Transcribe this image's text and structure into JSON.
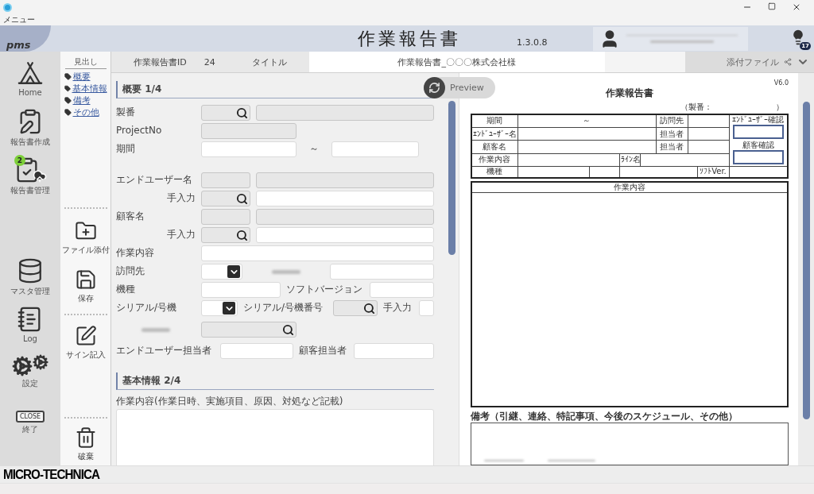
{
  "window": {
    "menu": "メニュー"
  },
  "header": {
    "logo": "pms",
    "title": "作業報告書",
    "version": "1.3.0.8",
    "notifications": "17"
  },
  "nav": {
    "top": [
      {
        "kind": "home",
        "label": "Home"
      },
      {
        "kind": "create",
        "label": "報告書作成"
      },
      {
        "kind": "manage",
        "label": "報告書管理",
        "badge": "2"
      }
    ],
    "bottom": [
      {
        "kind": "master",
        "label": "マスタ管理"
      },
      {
        "kind": "log",
        "label": "Log"
      },
      {
        "kind": "settings",
        "label": "設定"
      },
      {
        "kind": "close",
        "label": "終了",
        "sign": "CLOSE"
      }
    ]
  },
  "outline": {
    "heading": "見出し",
    "links": [
      "概要",
      "基本情報",
      "備考",
      "その他"
    ]
  },
  "actions": [
    {
      "kind": "attach",
      "label": "ファイル添付"
    },
    {
      "kind": "save",
      "label": "保存"
    },
    {
      "kind": "sign",
      "label": "サイン記入"
    },
    {
      "kind": "discard",
      "label": "破棄"
    }
  ],
  "topbar": {
    "id_label": "作業報告書ID",
    "id": "24",
    "title_label": "タイトル",
    "title_value": "作業報告書_〇〇〇株式会社様",
    "attachments": "添付ファイル"
  },
  "preview_button": "Preview",
  "form": {
    "sections": [
      {
        "title": "概要 1/4",
        "rows": [
          {
            "items": [
              {
                "kind": "label",
                "text": "製番"
              },
              {
                "kind": "search",
                "disabled": true
              },
              {
                "kind": "text",
                "disabled": true
              }
            ]
          },
          {
            "items": [
              {
                "kind": "label",
                "text": "ProjectNo"
              },
              {
                "kind": "text",
                "disabled": true
              }
            ]
          },
          {
            "items": [
              {
                "kind": "label",
                "text": "期間"
              },
              {
                "kind": "text",
                "disabled": false
              },
              {
                "kind": "tilde",
                "text": "～"
              },
              {
                "kind": "text",
                "disabled": false
              }
            ]
          },
          {
            "items": [
              {
                "kind": "label",
                "text": "エンドユーザー名"
              },
              {
                "kind": "text",
                "disabled": true
              },
              {
                "kind": "text",
                "disabled": true
              }
            ]
          },
          {
            "items": [
              {
                "kind": "sublabel",
                "text": "手入力"
              },
              {
                "kind": "search",
                "disabled": true
              },
              {
                "kind": "text",
                "disabled": false
              }
            ]
          },
          {
            "items": [
              {
                "kind": "label",
                "text": "顧客名"
              },
              {
                "kind": "text",
                "disabled": true
              },
              {
                "kind": "text",
                "disabled": true
              }
            ]
          },
          {
            "items": [
              {
                "kind": "sublabel",
                "text": "手入力"
              },
              {
                "kind": "search",
                "disabled": true
              },
              {
                "kind": "text",
                "disabled": false
              }
            ]
          },
          {
            "items": [
              {
                "kind": "label",
                "text": "作業内容"
              },
              {
                "kind": "text",
                "disabled": false
              }
            ]
          },
          {
            "items": [
              {
                "kind": "label",
                "text": "訪問先"
              },
              {
                "kind": "select",
                "disabled": false
              },
              {
                "kind": "redacted"
              },
              {
                "kind": "text",
                "disabled": false
              }
            ]
          },
          {
            "items": [
              {
                "kind": "label",
                "text": "機種"
              },
              {
                "kind": "text",
                "disabled": false
              },
              {
                "kind": "label",
                "text": "ソフトバージョン"
              },
              {
                "kind": "text",
                "disabled": false
              }
            ]
          },
          {
            "items": [
              {
                "kind": "label",
                "text": "シリアル/号機"
              },
              {
                "kind": "select",
                "disabled": false
              },
              {
                "kind": "label",
                "text": "シリアル/号機番号"
              },
              {
                "kind": "search",
                "disabled": true
              },
              {
                "kind": "label",
                "text": "手入力"
              },
              {
                "kind": "text",
                "disabled": false
              }
            ]
          },
          {
            "items": [
              {
                "kind": "redacted"
              },
              {
                "kind": "search",
                "disabled": true
              }
            ]
          },
          {
            "items": [
              {
                "kind": "label",
                "text": "エンドユーザー担当者"
              },
              {
                "kind": "text",
                "disabled": false
              },
              {
                "kind": "label",
                "text": "顧客担当者"
              },
              {
                "kind": "text",
                "disabled": false
              }
            ]
          }
        ]
      },
      {
        "title": "基本情報 2/4",
        "rows": [
          {
            "items": [
              {
                "kind": "caption",
                "text": "作業内容(作業日時、実施項目、原因、対処など記載)"
              }
            ]
          },
          {
            "items": [
              {
                "kind": "textarea",
                "disabled": false
              }
            ]
          }
        ]
      }
    ]
  },
  "document": {
    "title": "作業報告書",
    "version": "V6.0",
    "serial_label": "（製番：",
    "serial_close": "）",
    "fields": {
      "period": "期間",
      "tilde": "～",
      "visit": "訪問先",
      "end_user": "ｴﾝﾄﾞﾕｰｻﾞｰ名",
      "person1": "担当者",
      "customer": "顧客名",
      "person2": "担当者",
      "work": "作業内容",
      "line": "ﾗｲﾝ名",
      "model": "機種",
      "soft": "ｿﾌﾄVer.",
      "end_user_confirm": "ｴﾝﾄﾞﾕｰｻﾞｰ確認",
      "customer_confirm": "顧客確認"
    },
    "work_heading": "作業内容",
    "notes_label": "備考（引継、連絡、特記事項、今後のスケジュール、その他）"
  },
  "footer": {
    "logo": "MICRO-TECHNICA"
  }
}
